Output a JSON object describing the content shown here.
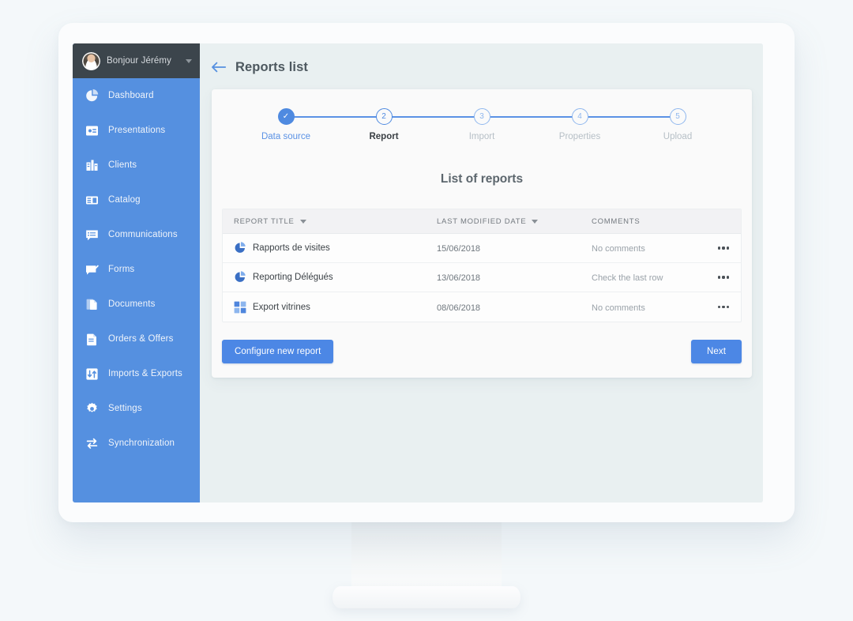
{
  "colors": {
    "sidebar_blue": "#5590e0",
    "accent_blue": "#4c87e5",
    "user_bar_dark": "#3c454c",
    "screen_bg": "#e9f0f1",
    "card_bg": "#fafafa"
  },
  "sidebar": {
    "user": {
      "greeting": "Bonjour Jérémy",
      "avatar_icon": "user-photo-avatar",
      "chevron_icon": "chevron-down-icon"
    },
    "items": [
      {
        "label": "Dashboard",
        "icon": "pie-chart-icon"
      },
      {
        "label": "Presentations",
        "icon": "presentation-icon"
      },
      {
        "label": "Clients",
        "icon": "building-icon"
      },
      {
        "label": "Catalog",
        "icon": "catalog-book-icon"
      },
      {
        "label": "Communications",
        "icon": "chat-list-icon"
      },
      {
        "label": "Forms",
        "icon": "form-check-icon"
      },
      {
        "label": "Documents",
        "icon": "documents-icon"
      },
      {
        "label": "Orders & Offers",
        "icon": "order-document-icon"
      },
      {
        "label": "Imports & Exports",
        "icon": "import-export-arrows-icon"
      },
      {
        "label": "Settings",
        "icon": "gear-icon"
      },
      {
        "label": "Synchronization",
        "icon": "sync-arrows-icon"
      }
    ]
  },
  "header": {
    "back_icon": "arrow-left-icon",
    "title": "Reports list"
  },
  "stepper": {
    "steps": [
      {
        "number": "1",
        "label": "Data source",
        "state": "done",
        "marker": "✓"
      },
      {
        "number": "2",
        "label": "Report",
        "state": "current",
        "marker": "2"
      },
      {
        "number": "3",
        "label": "Import",
        "state": "upcoming",
        "marker": "3"
      },
      {
        "number": "4",
        "label": "Properties",
        "state": "upcoming",
        "marker": "4"
      },
      {
        "number": "5",
        "label": "Upload",
        "state": "upcoming",
        "marker": "5"
      }
    ]
  },
  "main": {
    "list_heading": "List of reports",
    "table": {
      "columns": [
        {
          "label": "Report title",
          "sortable": true
        },
        {
          "label": "Last modified date",
          "sortable": true
        },
        {
          "label": "Comments",
          "sortable": false
        }
      ],
      "rows": [
        {
          "icon": "pie-chart-icon",
          "title": "Rapports de visites",
          "date": "15/06/2018",
          "comment": "No comments",
          "menu_icon": "ellipsis-horizontal-icon"
        },
        {
          "icon": "pie-chart-icon",
          "title": "Reporting Délégués",
          "date": "13/06/2018",
          "comment": "Check the last row",
          "menu_icon": "ellipsis-horizontal-icon"
        },
        {
          "icon": "grid-table-icon",
          "title": "Export vitrines",
          "date": "08/06/2018",
          "comment": "No comments",
          "menu_icon": "ellipsis-horizontal-icon"
        }
      ]
    },
    "footer": {
      "configure_label": "Configure new report",
      "next_label": "Next"
    }
  }
}
